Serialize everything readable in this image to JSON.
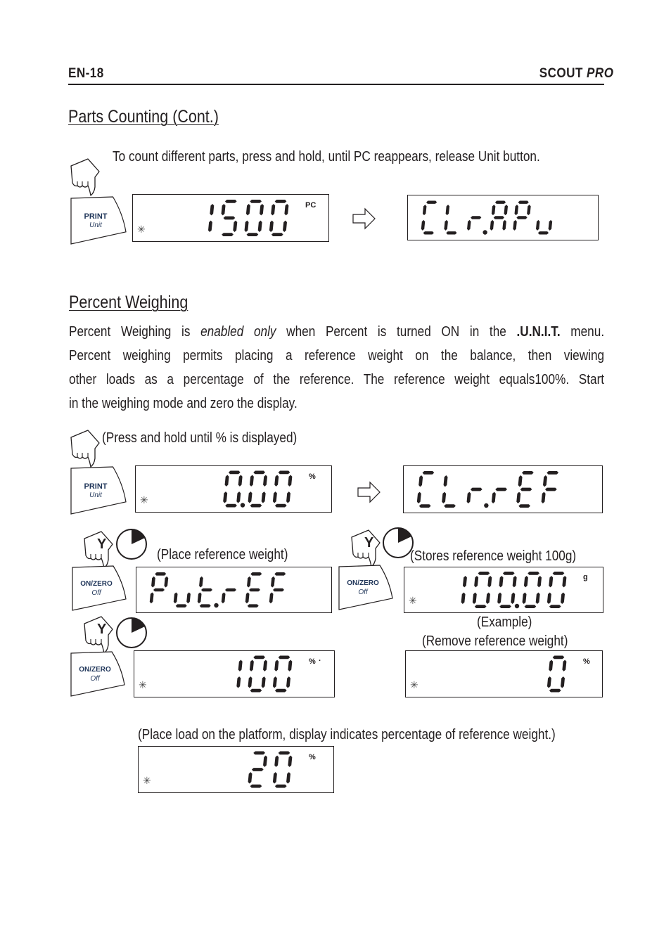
{
  "header": {
    "page_id": "EN-18",
    "product_name": "SCOUT",
    "product_suffix": "PRO"
  },
  "parts_counting": {
    "title": "Parts Counting (Cont.)",
    "instruction": "To count different parts, press and hold, until PC reappears, release Unit button.",
    "button": {
      "line1": "PRINT",
      "line2": "Unit"
    },
    "display_before": {
      "value": "1500",
      "unit": "PC",
      "stability": "*"
    },
    "display_after": {
      "value": "CLr.APu"
    }
  },
  "percent_weighing": {
    "title": "Percent Weighing",
    "paragraph": {
      "line1_a": "Percent Weighing is ",
      "line1_em": "enabled only",
      "line1_b": "  when Percent is turned ON in the ",
      "line1_strong": ".U.N.I.T.",
      "line1_c": " menu.",
      "line2": "Percent weighing permits placing a reference weight on the balance, then viewing",
      "line3": "other loads as a percentage of the reference. The reference weight equals100%.  Start",
      "line4": "in the weighing mode and zero the display."
    },
    "steps": {
      "step1_caption": "(Press and hold until % is displayed)",
      "print_button": {
        "line1": "PRINT",
        "line2": "Unit"
      },
      "zero_button": {
        "line1": "ON/ZERO",
        "line2": "Off"
      },
      "hand_letter": "Y",
      "display_zero": {
        "value": "0.00",
        "unit": "%",
        "stability": "*"
      },
      "display_clr_ref": {
        "value": "CLr.rEF"
      },
      "caption_place_ref": "(Place reference weight)",
      "display_put_ref": {
        "value": "Put.rEF"
      },
      "caption_stores_ref": "(Stores reference weight 100g)",
      "display_ref_weight": {
        "value": "100.00",
        "unit": "g",
        "stability": "*"
      },
      "caption_example": "(Example)",
      "caption_remove_ref": "(Remove reference weight)",
      "display_hundred": {
        "value": "100",
        "unit": "%",
        "stability": "*"
      },
      "display_zero_pct": {
        "value": "0",
        "unit": "%",
        "stability": "*"
      },
      "caption_place_load": "(Place load on the platform, display indicates percentage of reference weight.)",
      "display_load": {
        "value": "20",
        "unit": "%",
        "stability": "*"
      }
    }
  },
  "colors": {
    "text": "#231f20",
    "button_text": "#1f3559"
  }
}
